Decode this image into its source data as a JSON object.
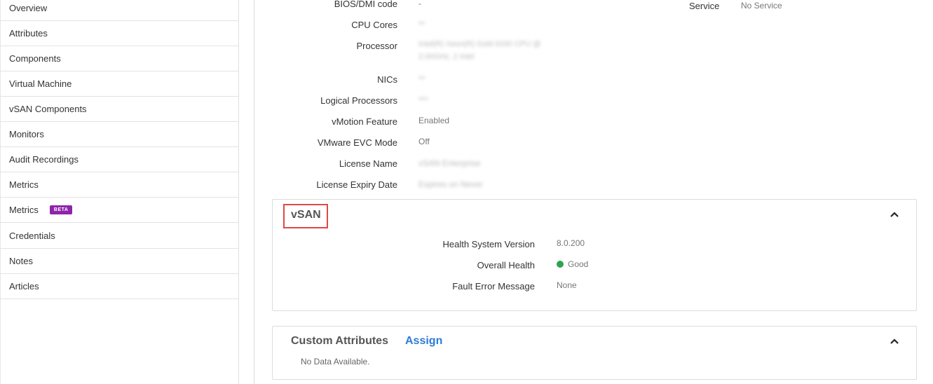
{
  "sidebar": {
    "items": [
      {
        "label": "Overview"
      },
      {
        "label": "Attributes"
      },
      {
        "label": "Components"
      },
      {
        "label": "Virtual Machine"
      },
      {
        "label": "vSAN Components"
      },
      {
        "label": "Monitors"
      },
      {
        "label": "Audit Recordings"
      },
      {
        "label": "Metrics"
      },
      {
        "label": "Metrics",
        "badge": "BETA"
      },
      {
        "label": "Credentials"
      },
      {
        "label": "Notes"
      },
      {
        "label": "Articles"
      }
    ]
  },
  "details": {
    "rows": [
      {
        "label": "BIOS/DMI code",
        "value": "-",
        "blurred": false
      },
      {
        "label": "CPU Cores",
        "value": "**",
        "blurred": true
      },
      {
        "label": "Processor",
        "value": "Intel(R) Xeon(R) Gold 6330 CPU @",
        "value2": "2.00GHz, 2 Intel",
        "blurred": true
      },
      {
        "label": "NICs",
        "value": "**",
        "blurred": true
      },
      {
        "label": "Logical Processors",
        "value": "***",
        "blurred": true
      },
      {
        "label": "vMotion Feature",
        "value": "Enabled",
        "blurred": false
      },
      {
        "label": "VMware EVC Mode",
        "value": "Off",
        "blurred": false
      },
      {
        "label": "License Name",
        "value": "vSAN Enterprise",
        "blurred": true
      },
      {
        "label": "License Expiry Date",
        "value": "Expires on Never",
        "blurred": true
      }
    ],
    "service": {
      "label": "Service",
      "value": "No Service"
    }
  },
  "vsan": {
    "title": "vSAN",
    "rows": [
      {
        "label": "Health System Version",
        "value": "8.0.200"
      },
      {
        "label": "Overall Health",
        "value": "Good",
        "status_color": "#2ea44f"
      },
      {
        "label": "Fault Error Message",
        "value": "None"
      }
    ]
  },
  "custom_attributes": {
    "title": "Custom Attributes",
    "assign_label": "Assign",
    "empty_text": "No Data Available."
  },
  "colors": {
    "accent": "#2d7bd8",
    "beta_badge": "#8e24aa",
    "highlight": "#e04848",
    "good": "#2ea44f"
  }
}
